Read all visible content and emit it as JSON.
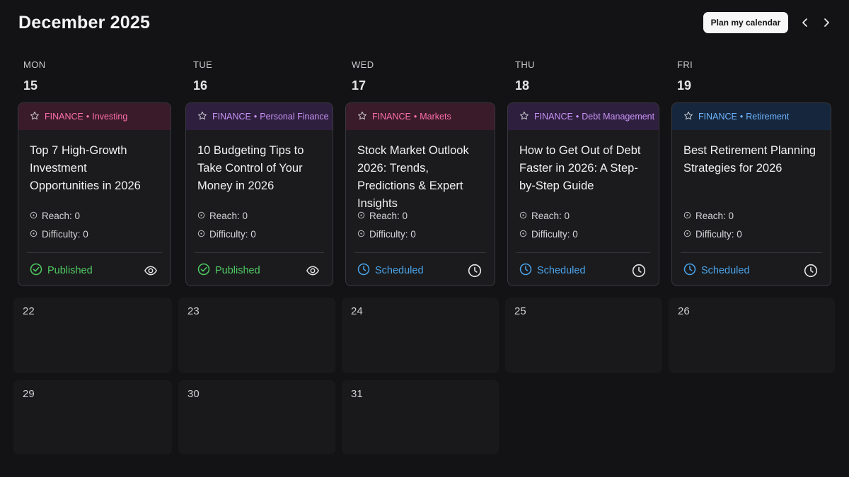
{
  "header": {
    "title": "December 2025",
    "plan_button": "Plan my calendar",
    "prev_icon": "chevron-left-icon",
    "next_icon": "chevron-right-icon"
  },
  "week1": {
    "days": [
      {
        "name": "MON",
        "date": "15"
      },
      {
        "name": "TUE",
        "date": "16"
      },
      {
        "name": "WED",
        "date": "17"
      },
      {
        "name": "THU",
        "date": "18"
      },
      {
        "name": "FRI",
        "date": "19"
      }
    ]
  },
  "cards": [
    {
      "category": "FINANCE",
      "separator": "•",
      "subcategory": "Investing",
      "title": "Top 7 High-Growth Investment Opportunities in 2026",
      "reach": "Reach: 0",
      "difficulty": "Difficulty: 0",
      "status": "Published",
      "action_icon": "eye-icon",
      "header_color": "#3a1b29",
      "text_color": "#ff6fae"
    },
    {
      "category": "FINANCE",
      "separator": "•",
      "subcategory": "Personal Finance",
      "title": "10 Budgeting Tips to Take Control of Your Money in 2026",
      "reach": "Reach: 0",
      "difficulty": "Difficulty: 0",
      "status": "Published",
      "action_icon": "eye-icon",
      "header_color": "#2e1f3f",
      "text_color": "#c993f5"
    },
    {
      "category": "FINANCE",
      "separator": "•",
      "subcategory": "Markets",
      "title": "Stock Market Outlook 2026: Trends, Predictions & Expert Insights",
      "reach": "Reach: 0",
      "difficulty": "Difficulty: 0",
      "status": "Scheduled",
      "action_icon": "clock-icon",
      "header_color": "#3a1b29",
      "text_color": "#ff6fae"
    },
    {
      "category": "FINANCE",
      "separator": "•",
      "subcategory": "Debt Management",
      "title": "How to Get Out of Debt Faster in 2026: A Step-by-Step Guide",
      "reach": "Reach: 0",
      "difficulty": "Difficulty: 0",
      "status": "Scheduled",
      "action_icon": "clock-icon",
      "header_color": "#2e1f3f",
      "text_color": "#c993f5"
    },
    {
      "category": "FINANCE",
      "separator": "•",
      "subcategory": "Retirement",
      "title": "Best Retirement Planning Strategies for 2026",
      "reach": "Reach: 0",
      "difficulty": "Difficulty: 0",
      "status": "Scheduled",
      "action_icon": "clock-icon",
      "header_color": "#16273d",
      "text_color": "#6fb4ff"
    }
  ],
  "status_colors": {
    "published": "#4fca62",
    "scheduled": "#4aa3e8"
  },
  "week2": [
    "22",
    "23",
    "24",
    "25",
    "26"
  ],
  "week3": [
    "29",
    "30",
    "31"
  ]
}
